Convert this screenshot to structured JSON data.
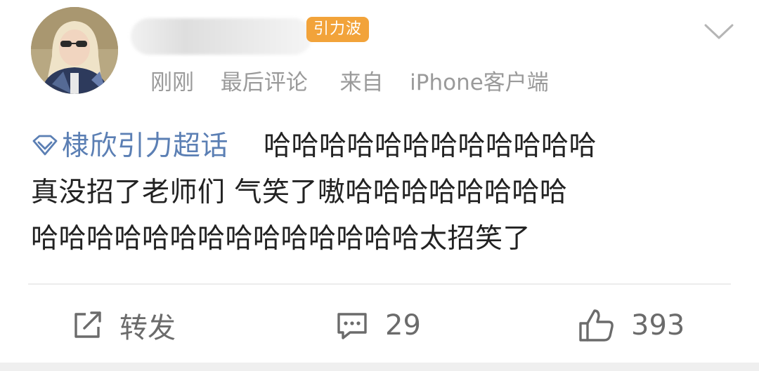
{
  "post": {
    "badge": "引力波",
    "meta": {
      "time": "刚刚",
      "last_comment": "最后评论",
      "source_prefix": "来自",
      "source": "iPhone客户端"
    },
    "topic": "棣欣引力超话",
    "text_line1": "哈哈哈哈哈哈哈哈哈哈哈哈",
    "text_line2": "真没招了老师们 气笑了嗷哈哈哈哈哈哈哈哈",
    "text_line3": "哈哈哈哈哈哈哈哈哈哈哈哈哈哈太招笑了"
  },
  "actions": {
    "repost_label": "转发",
    "comment_count": "29",
    "like_count": "393"
  },
  "icons": {
    "topic": "super-topic-diamond-icon",
    "menu": "chevron-down-icon",
    "repost": "repost-icon",
    "comment": "comment-icon",
    "like": "thumbs-up-icon"
  },
  "colors": {
    "badge": "#f2a33a",
    "link": "#5b7fb4",
    "meta": "#9a9a9a",
    "text": "#222222"
  }
}
